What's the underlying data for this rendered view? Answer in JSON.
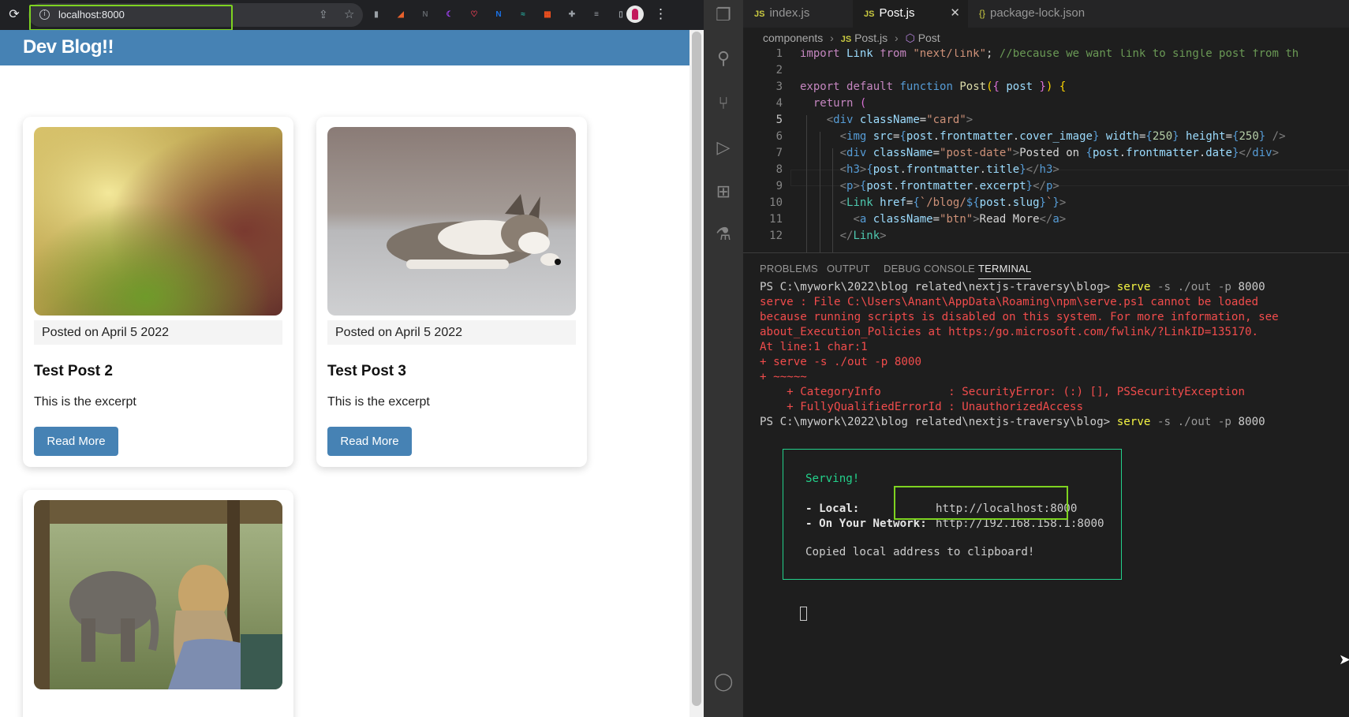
{
  "browser": {
    "url": "localhost:8000",
    "extensions": [
      {
        "name": "docs-icon",
        "glyph": "▮",
        "color": "#9aa0a6"
      },
      {
        "name": "matlab-icon",
        "glyph": "◢",
        "color": "#e8612c"
      },
      {
        "name": "notion-n-icon",
        "glyph": "N",
        "color": "#5f6368"
      },
      {
        "name": "moon-icon",
        "glyph": "☾",
        "color": "#a142f4"
      },
      {
        "name": "pocket-icon",
        "glyph": "♡",
        "color": "#ef4056"
      },
      {
        "name": "n-ext-icon",
        "glyph": "N",
        "color": "#1a73e8"
      },
      {
        "name": "wave-icon",
        "glyph": "≈",
        "color": "#26a69a"
      },
      {
        "name": "grid-ext-icon",
        "glyph": "▦",
        "color": "#f4511e"
      },
      {
        "name": "puzzle-icon",
        "glyph": "✚",
        "color": "#9aa0a6"
      },
      {
        "name": "media-icon",
        "glyph": "≡",
        "color": "#9aa0a6"
      },
      {
        "name": "sidepanel-icon",
        "glyph": "▯",
        "color": "#9aa0a6"
      }
    ]
  },
  "site": {
    "title": "Dev Blog!!",
    "cards": [
      {
        "date": "Posted on April 5 2022",
        "title": "Test Post 2",
        "excerpt": "This is the excerpt",
        "button": "Read More"
      },
      {
        "date": "Posted on April 5 2022",
        "title": "Test Post 3",
        "excerpt": "This is the excerpt",
        "button": "Read More"
      }
    ]
  },
  "vscode": {
    "tabs": [
      {
        "icon": "JS",
        "label": "index.js"
      },
      {
        "icon": "JS",
        "label": "Post.js",
        "close": "✕"
      },
      {
        "icon": "{}",
        "label": "package-lock.json"
      }
    ],
    "breadcrumb": [
      "components",
      "Post.js",
      "Post"
    ],
    "line_numbers": [
      "1",
      "2",
      "3",
      "4",
      "5",
      "6",
      "7",
      "8",
      "9",
      "10",
      "11",
      "12"
    ],
    "panel_tabs": [
      "PROBLEMS",
      "OUTPUT",
      "DEBUG CONSOLE",
      "TERMINAL"
    ],
    "terminal": {
      "prompt": "PS C:\\mywork\\2022\\blog related\\nextjs-traversy\\blog>",
      "cmd_name": "serve",
      "cmd_args_1": "-s ./out -p",
      "cmd_port": "8000",
      "errors": [
        "serve : File C:\\Users\\Anant\\AppData\\Roaming\\npm\\serve.ps1 cannot be loaded",
        "because running scripts is disabled on this system. For more information, see",
        "about_Execution_Policies at https:/go.microsoft.com/fwlink/?LinkID=135170.",
        "At line:1 char:1",
        "+ serve -s ./out -p 8000",
        "+ ~~~~~",
        "    + CategoryInfo          : SecurityError: (:) [], PSSecurityException",
        "    + FullyQualifiedErrorId : UnauthorizedAccess"
      ],
      "serving": "Serving!",
      "local_label": "- Local:",
      "local_url": "http://localhost:8000",
      "network_label": "- On Your Network:",
      "network_url": "http://192.168.158.1:8000",
      "copied": "Copied local address to clipboard!"
    }
  }
}
